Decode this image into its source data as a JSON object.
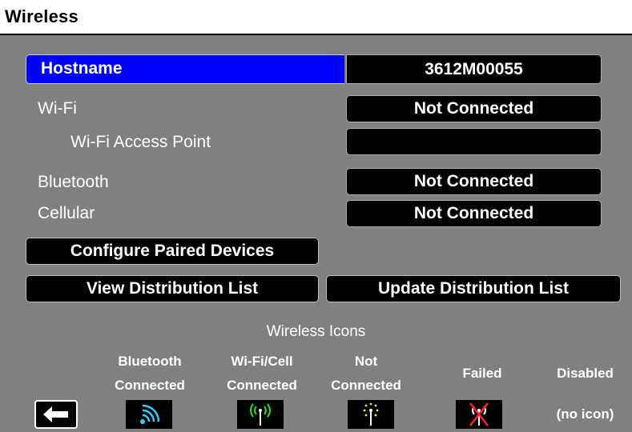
{
  "title": "Wireless",
  "rows": {
    "hostname": {
      "label": "Hostname",
      "value": "3612M00055"
    },
    "wifi": {
      "label": "Wi-Fi",
      "value": "Not Connected"
    },
    "wifi_ap": {
      "label": "Wi-Fi Access Point",
      "value": ""
    },
    "bluetooth": {
      "label": "Bluetooth",
      "value": "Not Connected"
    },
    "cellular": {
      "label": "Cellular",
      "value": "Not Connected"
    }
  },
  "buttons": {
    "configure": "Configure Paired Devices",
    "view_dist": "View Distribution List",
    "update_dist": "Update Distribution List"
  },
  "legend": {
    "title": "Wireless Icons",
    "bt_line1": "Bluetooth",
    "bt_line2": "Connected",
    "wc_line1": "Wi-Fi/Cell",
    "wc_line2": "Connected",
    "nc_line1": "Not",
    "nc_line2": "Connected",
    "failed": "Failed",
    "disabled": "Disabled",
    "no_icon": "(no icon)"
  },
  "icons": {
    "back": "left-arrow-icon",
    "bluetooth": "bluetooth-connected-icon",
    "wifi_cell": "antenna-connected-icon",
    "not_connected": "antenna-searching-icon",
    "failed": "antenna-failed-icon"
  },
  "colors": {
    "background": "#808080",
    "selected": "#0000ff",
    "connected_green": "#22dd22",
    "searching_yellow": "#ffee00",
    "bluetooth_cyan": "#33ccff",
    "failed_red": "#ff2222"
  }
}
